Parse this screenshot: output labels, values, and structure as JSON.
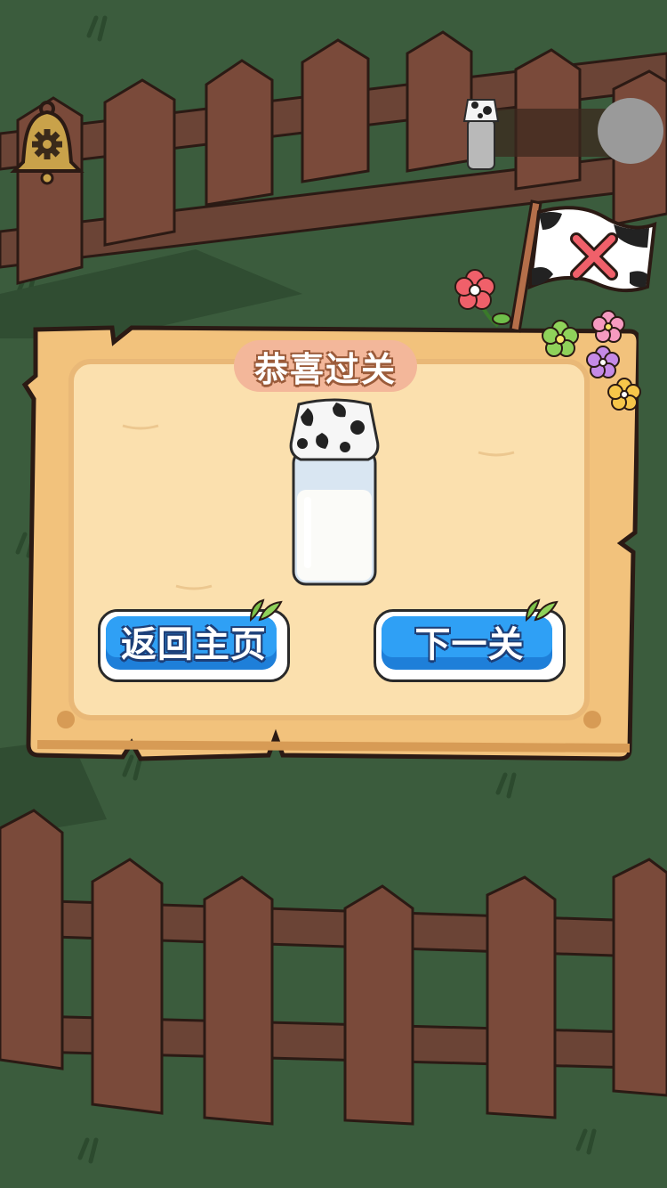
{
  "dialog": {
    "title": "恭喜过关",
    "home_button": "返回主页",
    "next_button": "下一关"
  },
  "icons": {
    "settings": "bell-gear-icon",
    "counter": "milk-bottle-icon",
    "flag": "cow-pattern-flag-with-x"
  },
  "colors": {
    "grass": "#3b5c3d",
    "board": "#f5cf8b",
    "button": "#2fa0f5",
    "title_pill": "#f3b79a"
  }
}
